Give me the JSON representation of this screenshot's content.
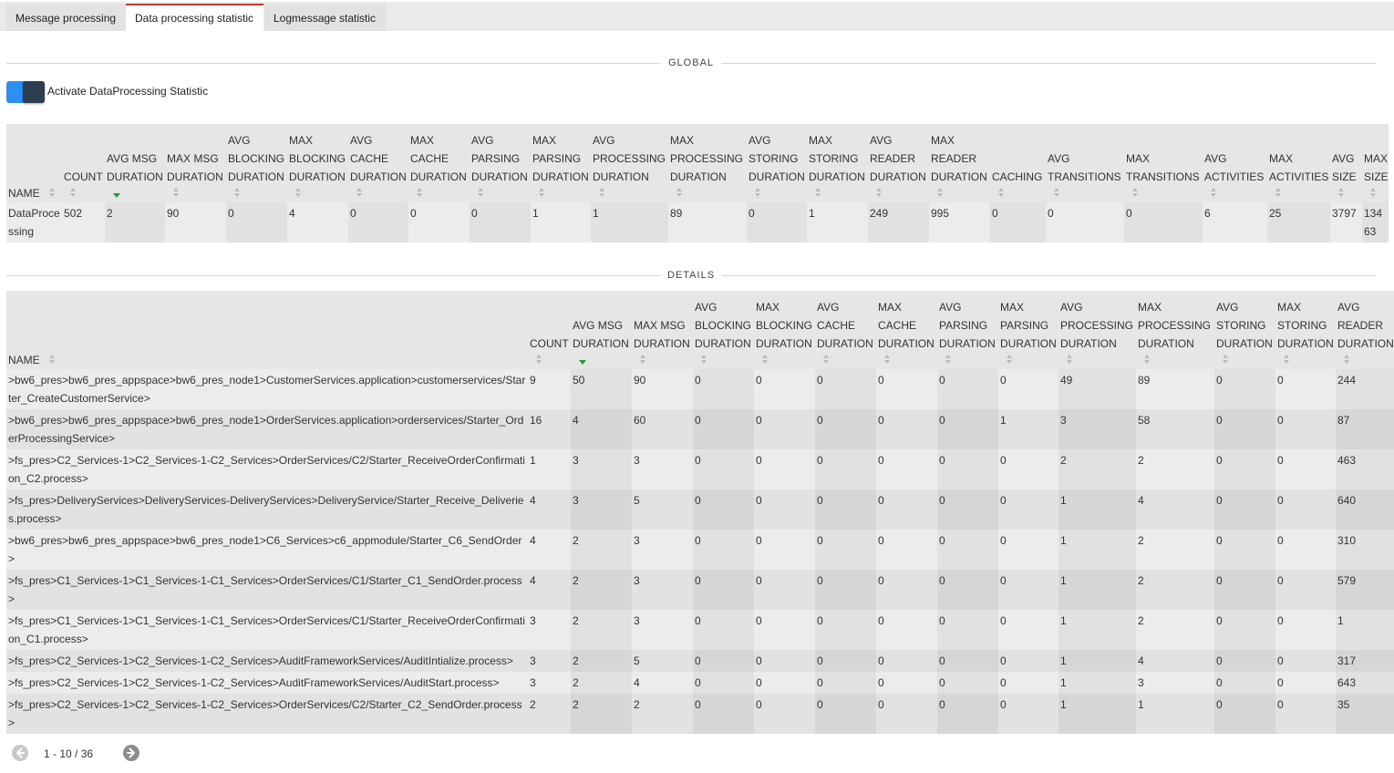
{
  "tabs": [
    {
      "label": "Message processing",
      "active": false
    },
    {
      "label": "Data processing statistic",
      "active": true
    },
    {
      "label": "Logmessage statistic",
      "active": false
    }
  ],
  "global": {
    "title": "GLOBAL",
    "toggle_label": "Activate DataProcessing Statistic",
    "toggle_on": true,
    "columns": [
      "NAME",
      "COUNT",
      "AVG MSG DURATION",
      "MAX MSG DURATION",
      "AVG BLOCKING DURATION",
      "MAX BLOCKING DURATION",
      "AVG CACHE DURATION",
      "MAX CACHE DURATION",
      "AVG PARSING DURATION",
      "MAX PARSING DURATION",
      "AVG PROCESSING DURATION",
      "MAX PROCESSING DURATION",
      "AVG STORING DURATION",
      "MAX STORING DURATION",
      "AVG READER DURATION",
      "MAX READER DURATION",
      "CACHING",
      "AVG TRANSITIONS",
      "MAX TRANSITIONS",
      "AVG ACTIVITIES",
      "MAX ACTIVITIES",
      "AVG SIZE",
      "MAX SIZE"
    ],
    "rows": [
      [
        "DataProcessing",
        "502",
        "2",
        "90",
        "0",
        "4",
        "0",
        "0",
        "0",
        "1",
        "1",
        "89",
        "0",
        "1",
        "249",
        "995",
        "0",
        "0",
        "0",
        "6",
        "25",
        "3797",
        "13463"
      ]
    ]
  },
  "details": {
    "title": "DETAILS",
    "columns": [
      "NAME",
      "COUNT",
      "AVG MSG DURATION",
      "MAX MSG DURATION",
      "AVG BLOCKING DURATION",
      "MAX BLOCKING DURATION",
      "AVG CACHE DURATION",
      "MAX CACHE DURATION",
      "AVG PARSING DURATION",
      "MAX PARSING DURATION",
      "AVG PROCESSING DURATION",
      "MAX PROCESSING DURATION",
      "AVG STORING DURATION",
      "MAX STORING DURATION",
      "AVG READER DURATION"
    ],
    "rows": [
      [
        ">bw6_pres>bw6_pres_appspace>bw6_pres_node1>CustomerServices.application>customerservices/Starter_CreateCustomerService>",
        "9",
        "50",
        "90",
        "0",
        "0",
        "0",
        "0",
        "0",
        "0",
        "49",
        "89",
        "0",
        "0",
        "244"
      ],
      [
        ">bw6_pres>bw6_pres_appspace>bw6_pres_node1>OrderServices.application>orderservices/Starter_OrderProcessingService>",
        "16",
        "4",
        "60",
        "0",
        "0",
        "0",
        "0",
        "0",
        "1",
        "3",
        "58",
        "0",
        "0",
        "87"
      ],
      [
        ">fs_pres>C2_Services-1>C2_Services-1-C2_Services>OrderServices/C2/Starter_ReceiveOrderConfirmation_C2.process>",
        "1",
        "3",
        "3",
        "0",
        "0",
        "0",
        "0",
        "0",
        "0",
        "2",
        "2",
        "0",
        "0",
        "463"
      ],
      [
        ">fs_pres>DeliveryServices>DeliveryServices-DeliveryServices>DeliveryService/Starter_Receive_Deliveries.process>",
        "4",
        "3",
        "5",
        "0",
        "0",
        "0",
        "0",
        "0",
        "0",
        "1",
        "4",
        "0",
        "0",
        "640"
      ],
      [
        ">bw6_pres>bw6_pres_appspace>bw6_pres_node1>C6_Services>c6_appmodule/Starter_C6_SendOrder>",
        "4",
        "2",
        "3",
        "0",
        "0",
        "0",
        "0",
        "0",
        "0",
        "1",
        "2",
        "0",
        "0",
        "310"
      ],
      [
        ">fs_pres>C1_Services-1>C1_Services-1-C1_Services>OrderServices/C1/Starter_C1_SendOrder.process>",
        "4",
        "2",
        "3",
        "0",
        "0",
        "0",
        "0",
        "0",
        "0",
        "1",
        "2",
        "0",
        "0",
        "579"
      ],
      [
        ">fs_pres>C1_Services-1>C1_Services-1-C1_Services>OrderServices/C1/Starter_ReceiveOrderConfirmation_C1.process>",
        "3",
        "2",
        "3",
        "0",
        "0",
        "0",
        "0",
        "0",
        "0",
        "1",
        "2",
        "0",
        "0",
        "1"
      ],
      [
        ">fs_pres>C2_Services-1>C2_Services-1-C2_Services>AuditFrameworkServices/AuditIntialize.process>",
        "3",
        "2",
        "5",
        "0",
        "0",
        "0",
        "0",
        "0",
        "0",
        "1",
        "4",
        "0",
        "0",
        "317"
      ],
      [
        ">fs_pres>C2_Services-1>C2_Services-1-C2_Services>AuditFrameworkServices/AuditStart.process>",
        "3",
        "2",
        "4",
        "0",
        "0",
        "0",
        "0",
        "0",
        "0",
        "1",
        "3",
        "0",
        "0",
        "643"
      ],
      [
        ">fs_pres>C2_Services-1>C2_Services-1-C2_Services>OrderServices/C2/Starter_C2_SendOrder.process>",
        "2",
        "2",
        "2",
        "0",
        "0",
        "0",
        "0",
        "0",
        "0",
        "1",
        "1",
        "0",
        "0",
        "35"
      ]
    ]
  },
  "pager": {
    "info": "1 - 10 / 36"
  }
}
